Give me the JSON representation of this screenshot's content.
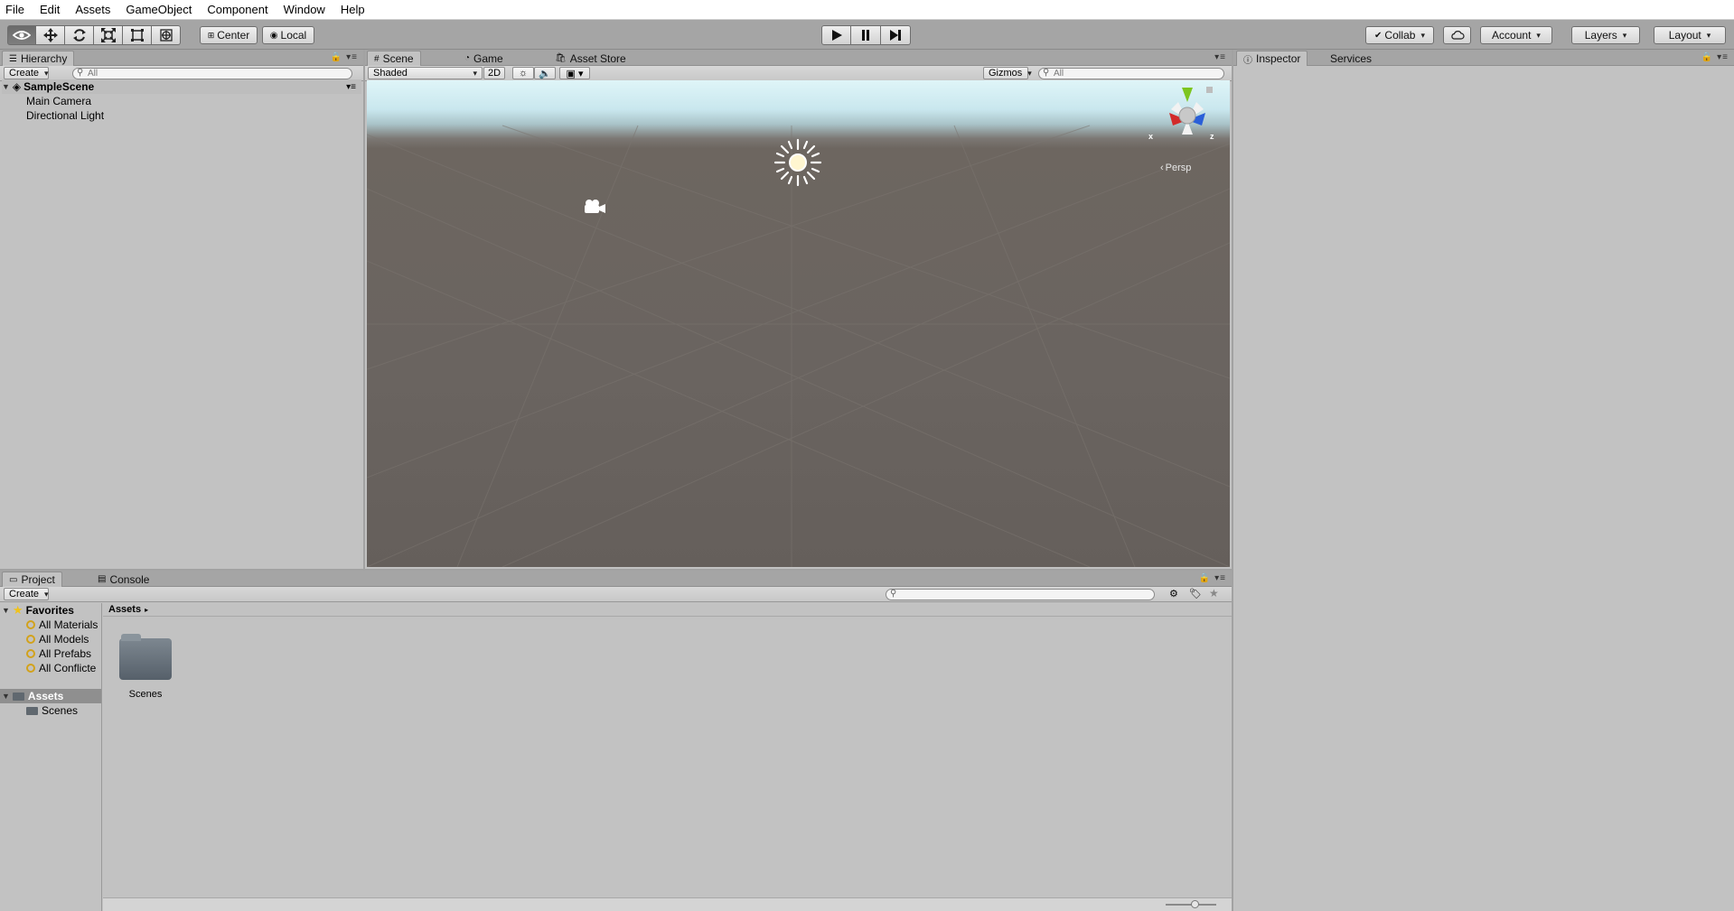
{
  "menu": [
    "File",
    "Edit",
    "Assets",
    "GameObject",
    "Component",
    "Window",
    "Help"
  ],
  "toolbar": {
    "tools": [
      "view-tool",
      "move-tool",
      "rotate-tool",
      "scale-tool",
      "rect-tool",
      "transform-tool"
    ],
    "pivot_label": "Center",
    "space_label": "Local",
    "collab_label": "Collab",
    "account_label": "Account",
    "layers_label": "Layers",
    "layout_label": "Layout"
  },
  "hierarchy": {
    "tab": "Hierarchy",
    "create_label": "Create",
    "search_placeholder": "All",
    "scene": "SampleScene",
    "items": [
      "Main Camera",
      "Directional Light"
    ]
  },
  "scene_panel": {
    "tabs": [
      "Scene",
      "Game",
      "Asset Store"
    ],
    "shading": "Shaded",
    "mode_2d": "2D",
    "gizmos_label": "Gizmos",
    "search_placeholder": "All",
    "projection": "Persp",
    "axis_x": "x",
    "axis_z": "z"
  },
  "inspector": {
    "tabs": [
      "Inspector",
      "Services"
    ]
  },
  "project": {
    "tabs": [
      "Project",
      "Console"
    ],
    "create_label": "Create",
    "favorites_label": "Favorites",
    "favorites": [
      "All Materials",
      "All Models",
      "All Prefabs",
      "All Conflicte"
    ],
    "assets_label": "Assets",
    "asset_folders": [
      "Scenes"
    ],
    "breadcrumb": "Assets",
    "grid_items": [
      "Scenes"
    ]
  },
  "colors": {
    "panel_bg": "#c2c2c2",
    "toolbar_bg": "#a5a5a5",
    "sky": "#dff5f8",
    "ground": "#6a6460",
    "axis_x": "#d22a2a",
    "axis_y": "#7dc51f",
    "axis_z": "#2a5fd8"
  }
}
